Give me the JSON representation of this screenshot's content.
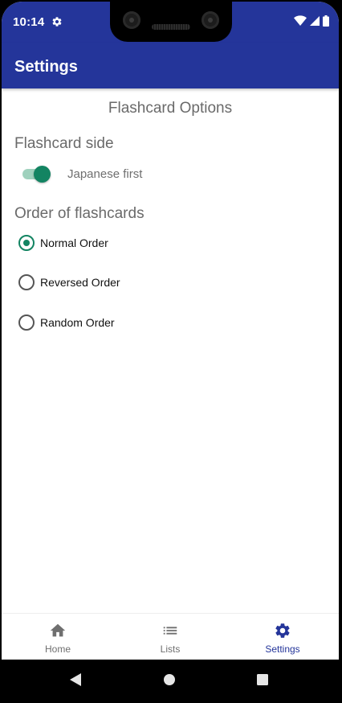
{
  "status_bar": {
    "time": "10:14",
    "icons": [
      "gear-icon",
      "wifi-icon",
      "signal-icon",
      "battery-icon"
    ]
  },
  "app_bar": {
    "title": "Settings"
  },
  "main": {
    "heading": "Flashcard Options",
    "flashcard_side": {
      "title": "Flashcard side",
      "toggle_label": "Japanese first",
      "toggle_on": true
    },
    "order": {
      "title": "Order of flashcards",
      "options": [
        {
          "label": "Normal Order",
          "selected": true
        },
        {
          "label": "Reversed Order",
          "selected": false
        },
        {
          "label": "Random Order",
          "selected": false
        }
      ]
    }
  },
  "bottom_nav": {
    "items": [
      {
        "label": "Home",
        "icon": "home-icon"
      },
      {
        "label": "Lists",
        "icon": "list-icon"
      },
      {
        "label": "Settings",
        "icon": "gear-icon",
        "active": true
      }
    ]
  },
  "colors": {
    "primary": "#24359a",
    "accent": "#138462",
    "accent_light": "#9fd1bd"
  }
}
